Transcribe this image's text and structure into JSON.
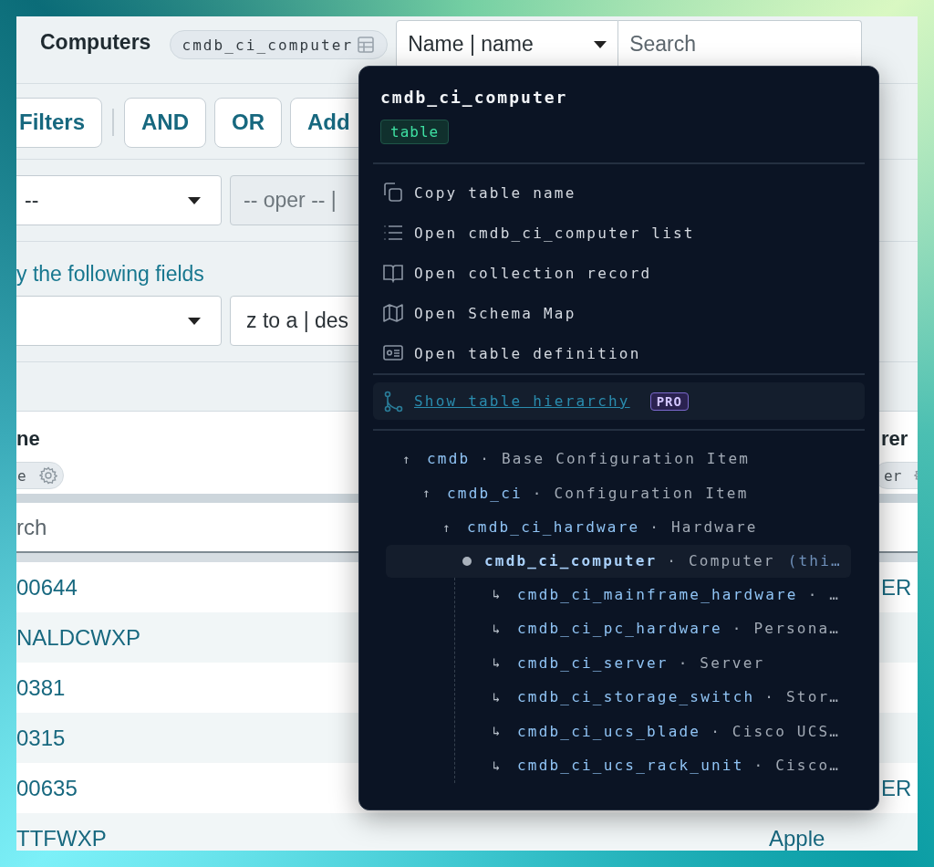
{
  "header": {
    "title": "Computers",
    "table_chip": "cmdb_ci_computer",
    "field_select": "Name | name",
    "search": {
      "placeholder": "Search"
    }
  },
  "filter_buttons": [
    {
      "label": "Filters"
    },
    {
      "label": "AND"
    },
    {
      "label": "OR"
    },
    {
      "label": "Add"
    }
  ],
  "condition": {
    "field_select": "--",
    "operator_select": {
      "value": "-- oper -- |",
      "disabled": true
    }
  },
  "sort": {
    "link": "y the following fields",
    "order_select": "z to a | des"
  },
  "table": {
    "columns": [
      {
        "title": "ne",
        "chip": "e"
      },
      {
        "title": "rer",
        "chip": "er"
      }
    ],
    "search": {
      "placeholder": "rch"
    },
    "rows": [
      {
        "column_1": "00644",
        "column_2": {
          "text": "ER",
          "kind": "clipped"
        }
      },
      {
        "column_1": "NALDCWXP"
      },
      {
        "column_1": "0381"
      },
      {
        "column_1": "0315"
      },
      {
        "column_1": "00635",
        "column_2": {
          "text": "ER",
          "kind": "clipped"
        }
      },
      {
        "column_1": "TTFWXP",
        "column_2": {
          "text": "Apple",
          "kind": "full"
        }
      }
    ]
  },
  "popover": {
    "title": "cmdb_ci_computer",
    "badge": "table",
    "actions": [
      {
        "kind": "copy",
        "label": "Copy table name"
      },
      {
        "kind": "list",
        "label": "Open cmdb_ci_computer list"
      },
      {
        "kind": "book",
        "label": "Open collection record"
      },
      {
        "kind": "map",
        "label": "Open Schema Map"
      },
      {
        "kind": "card",
        "label": "Open table definition"
      }
    ],
    "hierarchy_link": {
      "label": "Show table hierarchy",
      "badge": "PRO"
    },
    "tree": [
      {
        "name": "cmdb",
        "description": "· Base Configuration Item",
        "marker": "↑",
        "selected": false,
        "children": [
          {
            "name": "cmdb_ci",
            "description": "· Configuration Item",
            "marker": "↑",
            "selected": false,
            "children": [
              {
                "name": "cmdb_ci_hardware",
                "description": "· Hardware",
                "marker": "↑",
                "selected": false,
                "children": [
                  {
                    "name": "cmdb_ci_computer",
                    "description": "· Computer",
                    "note": "(thi…",
                    "selected": true,
                    "children": [
                      {
                        "name": "cmdb_ci_mainframe_hardware",
                        "description": "· …",
                        "marker": "↳",
                        "selected": false
                      },
                      {
                        "name": "cmdb_ci_pc_hardware",
                        "description": "· Persona…",
                        "marker": "↳",
                        "selected": false
                      },
                      {
                        "name": "cmdb_ci_server",
                        "description": "· Server",
                        "marker": "↳",
                        "selected": false
                      },
                      {
                        "name": "cmdb_ci_storage_switch",
                        "description": "· Stor…",
                        "marker": "↳",
                        "selected": false
                      },
                      {
                        "name": "cmdb_ci_ucs_blade",
                        "description": "· Cisco UCS…",
                        "marker": "↳",
                        "selected": false
                      },
                      {
                        "name": "cmdb_ci_ucs_rack_unit",
                        "description": "· Cisco…",
                        "marker": "↳",
                        "selected": false
                      }
                    ]
                  }
                ]
              }
            ]
          }
        ]
      }
    ]
  }
}
